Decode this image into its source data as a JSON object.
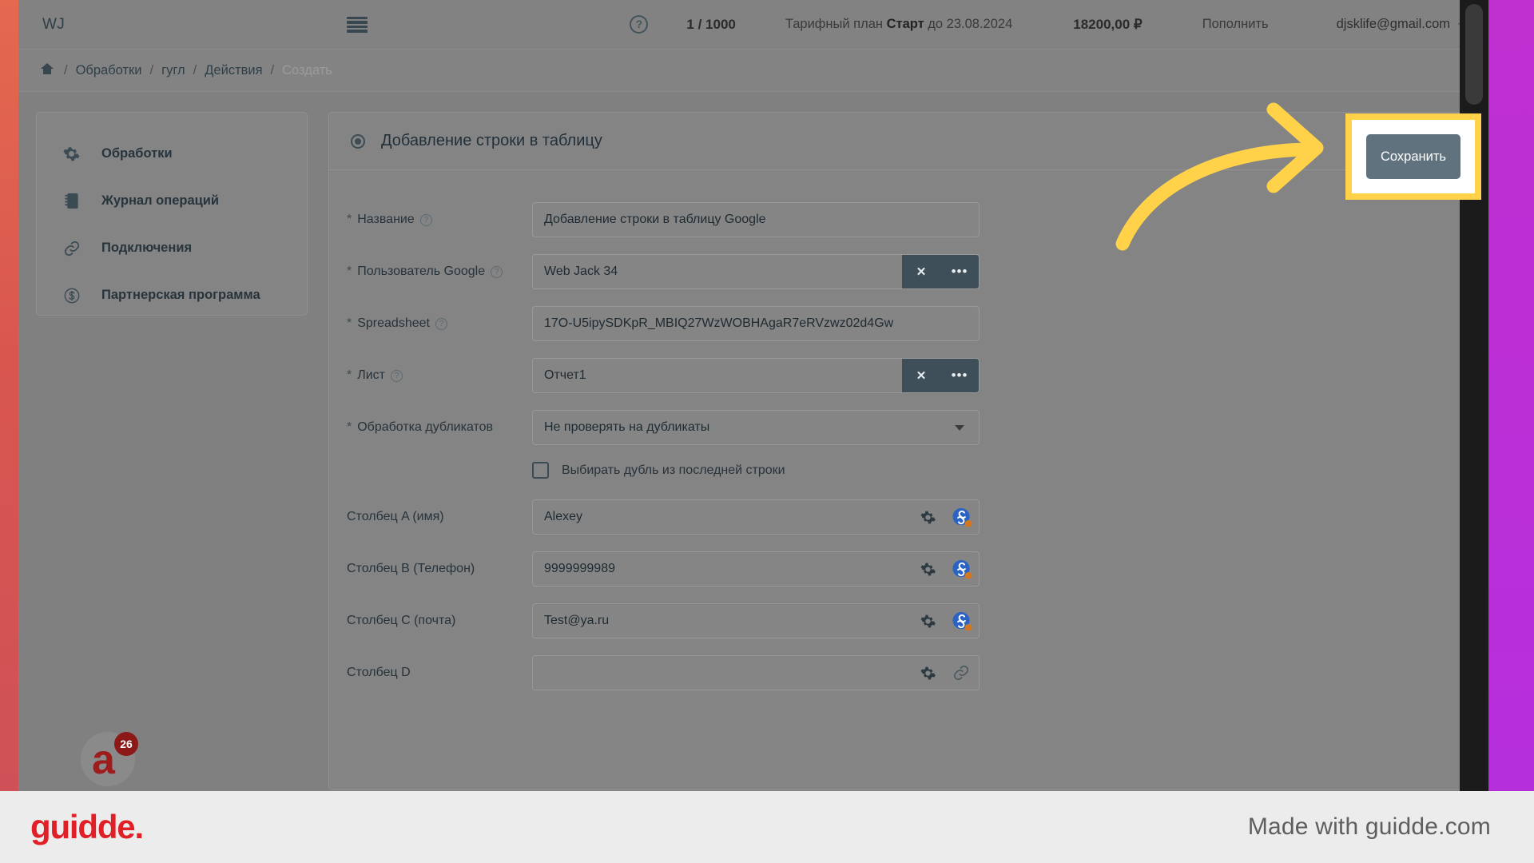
{
  "topbar": {
    "brand": "WJ",
    "menu_icon": "hamburger-icon",
    "help_icon": "?",
    "quota": "1 / 1000",
    "plan_prefix": "Тарифный план ",
    "plan_name": "Старт",
    "plan_suffix": " до 23.08.2024",
    "balance": "18200,00 ₽",
    "topup": "Пополнить",
    "account": "djsklife@gmail.com"
  },
  "breadcrumb": {
    "home_icon": "⌂",
    "items": [
      {
        "label": "Обработки",
        "muted": false
      },
      {
        "label": "гугл",
        "muted": false
      },
      {
        "label": "Действия",
        "muted": false
      },
      {
        "label": "Создать",
        "muted": true
      }
    ],
    "separator": "/"
  },
  "sidebar": {
    "items": [
      {
        "label": "Обработки",
        "icon": "gear-icon"
      },
      {
        "label": "Журнал операций",
        "icon": "notebook-icon"
      },
      {
        "label": "Подключения",
        "icon": "link-icon"
      },
      {
        "label": "Партнерская программа",
        "icon": "dollar-circle-icon"
      }
    ]
  },
  "panel": {
    "title": "Добавление строки в таблицу",
    "save_label": "Сохранить"
  },
  "form": {
    "rows": [
      {
        "required": true,
        "label": "Название",
        "help": true,
        "value": "Добавление строки в таблицу Google",
        "trailing": "none"
      },
      {
        "required": true,
        "label": "Пользователь Google",
        "help": true,
        "value": "Web Jack 34",
        "trailing": "clear-more"
      },
      {
        "required": true,
        "label": "Spreadsheet",
        "help": true,
        "value": "17O-U5ipySDKpR_MBIQ27WzWOBHAgaR7eRVzwz02d4Gw",
        "trailing": "none"
      },
      {
        "required": true,
        "label": "Лист",
        "help": true,
        "value": "Отчет1",
        "trailing": "clear-more"
      },
      {
        "required": true,
        "label": "Обработка дубликатов",
        "help": false,
        "value": "Не проверять на дубликаты",
        "trailing": "select"
      }
    ],
    "clear_glyph": "✕",
    "more_glyph": "•••",
    "checkbox": {
      "label": "Выбирать дубль из последней строки",
      "checked": false
    },
    "columns": [
      {
        "label": "Столбец A (имя)",
        "value": "Alexey",
        "icon": "linked-avatar-icon"
      },
      {
        "label": "Столбец B (Телефон)",
        "value": "9999999989",
        "icon": "linked-avatar-icon"
      },
      {
        "label": "Столбец C (почта)",
        "value": "Test@ya.ru",
        "icon": "linked-avatar-icon"
      },
      {
        "label": "Столбец D",
        "value": "",
        "icon": "link-icon"
      }
    ]
  },
  "badge": {
    "letter": "a",
    "count": "26"
  },
  "guidde": {
    "logo": "guidde.",
    "made_with": "Made with guidde.com"
  },
  "colors": {
    "highlight": "#ffd24a",
    "accent_dark": "#3f4f59",
    "save_button": "#5f727e",
    "guidde_red": "#e01f26",
    "left_edge": "#d9564f",
    "right_edge": "#bb2fd6"
  }
}
